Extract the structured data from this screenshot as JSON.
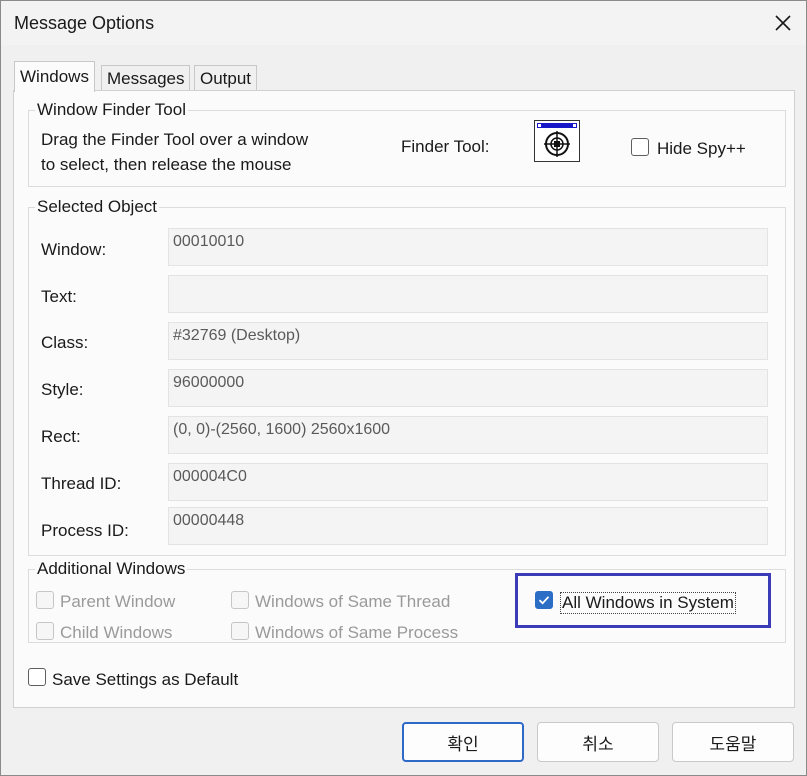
{
  "window": {
    "title": "Message Options"
  },
  "tabs": [
    "Windows",
    "Messages",
    "Output"
  ],
  "finder_group": {
    "title": "Window Finder Tool",
    "instructions_line1": "Drag the Finder Tool over a window",
    "instructions_line2": "to select, then release the mouse",
    "finder_label": "Finder Tool:",
    "hide_spy_label": "Hide Spy++",
    "hide_spy_checked": false
  },
  "selected_object": {
    "title": "Selected Object",
    "fields": [
      {
        "label": "Window:",
        "value": "00010010"
      },
      {
        "label": "Text:",
        "value": ""
      },
      {
        "label": "Class:",
        "value": "#32769 (Desktop)"
      },
      {
        "label": "Style:",
        "value": "96000000"
      },
      {
        "label": "Rect:",
        "value": "(0, 0)-(2560, 1600) 2560x1600"
      },
      {
        "label": "Thread ID:",
        "value": "000004C0"
      },
      {
        "label": "Process ID:",
        "value": "00000448"
      }
    ]
  },
  "additional_windows": {
    "title": "Additional Windows",
    "parent_window": "Parent Window",
    "child_windows": "Child Windows",
    "same_thread": "Windows of Same Thread",
    "same_process": "Windows of Same Process",
    "all_windows": "All Windows in System",
    "all_windows_checked": true
  },
  "save_settings": {
    "label": "Save Settings as Default",
    "checked": false
  },
  "buttons": {
    "ok": "확인",
    "cancel": "취소",
    "help": "도움말"
  },
  "colors": {
    "accent": "#2c6ec6",
    "highlight_border": "#3b3bb8"
  }
}
